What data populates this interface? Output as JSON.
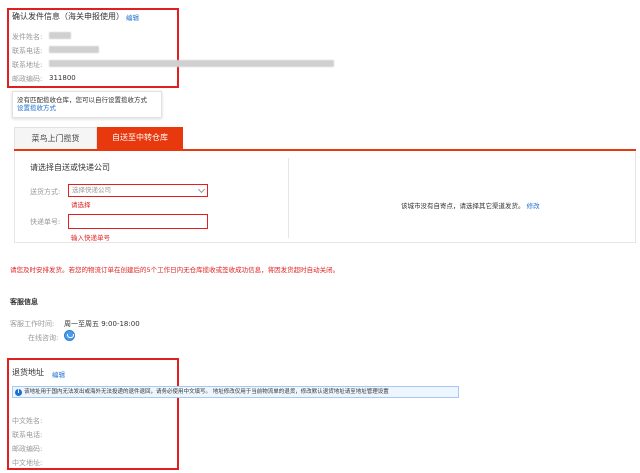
{
  "sender": {
    "title": "确认发件信息（海关申报使用）",
    "edit_label": "编辑",
    "name_label": "发件姓名:",
    "phone_label": "联系电话:",
    "address_label": "联系地址:",
    "postal_label": "邮政编码:",
    "postal_value": "311800"
  },
  "tooltip": {
    "text": "没有匹配揽收仓库，您可以自行设置揽收方式",
    "link": "设置揽收方式"
  },
  "tabs": [
    {
      "label": "菜鸟上门揽货",
      "active": false
    },
    {
      "label": "自送至中转仓库",
      "active": true
    }
  ],
  "delivery": {
    "heading": "请选择自送或快递公司",
    "method_label": "送货方式:",
    "method_placeholder": "选择快递公司",
    "method_error": "请选择",
    "tracking_label": "快递单号:",
    "tracking_error": "输入快递单号",
    "no_station_text": "该城市没有自寄点，请选择其它渠道发货。",
    "modify_link": "修改"
  },
  "warning": "请您及时安排发货。若您的物流订单在创建后的5个工作日内无仓库揽收或签收成功信息，将因发货超时自动关闭。",
  "customer_service": {
    "title": "客服信息",
    "hours_label": "客服工作时间:",
    "hours_value": "周一至周五 9:00-18:00",
    "consult_label": "在线咨询:"
  },
  "return_address": {
    "title": "退货地址",
    "edit_label": "编辑",
    "notice": "该地址用于国内无法发出或海外无法投递的退件退回，请务必使用中文填写。 地址修改仅用于当前物流单的退货，修改默认退货地址请至地址管理设置",
    "name_label": "中文姓名:",
    "phone_label": "联系电话:",
    "postal_label": "邮政编码:",
    "address_label": "中文地址:"
  },
  "colors": {
    "accent": "#e8380d",
    "highlight_box": "#e02020",
    "link": "#1c6fd1"
  }
}
